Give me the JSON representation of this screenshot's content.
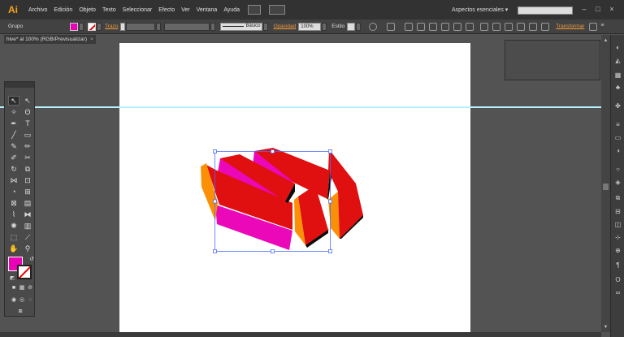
{
  "app": {
    "logo": "Ai"
  },
  "menu": [
    "Archivo",
    "Edición",
    "Objeto",
    "Texto",
    "Seleccionar",
    "Efecto",
    "Ver",
    "Ventana",
    "Ayuda"
  ],
  "workspace": {
    "label": "Aspectos esenciales",
    "chevron": "▾"
  },
  "window_controls": [
    "–",
    "□",
    "×"
  ],
  "control_bar": {
    "selection_type": "Grupo",
    "fill_color": "#ec00b7",
    "stroke_label": "Trazo",
    "brush_label": "Básico",
    "opacity_label": "Opacidad",
    "opacity_value": "100%",
    "style_label": "Estilo",
    "transform_label": "Transformar"
  },
  "document": {
    "tab_title": "hive* al 100% (RGB/Previsualizar)",
    "close": "×"
  },
  "artwork": {
    "colors": {
      "red": "#e00f10",
      "magenta": "#ea08b8",
      "orange": "#fb8f06",
      "black": "#0c0c0c",
      "selection": "#4d6cff"
    }
  },
  "toolbox": {
    "tools": [
      "selection-tool",
      "direct-selection-tool",
      "magic-wand-tool",
      "lasso-tool",
      "pen-tool",
      "type-tool",
      "line-tool",
      "rectangle-tool",
      "paintbrush-tool",
      "pencil-tool",
      "blob-brush-tool",
      "eraser-tool",
      "rotate-tool",
      "scale-tool",
      "width-tool",
      "free-transform-tool",
      "shape-builder-tool",
      "perspective-tool",
      "mesh-tool",
      "gradient-tool",
      "eyedropper-tool",
      "blend-tool",
      "symbol-sprayer-tool",
      "column-graph-tool",
      "artboard-tool",
      "slice-tool",
      "hand-tool",
      "zoom-tool"
    ],
    "fill_color": "#ec00b7"
  }
}
